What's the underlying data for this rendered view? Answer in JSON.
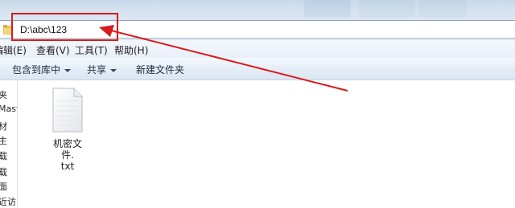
{
  "address": {
    "path": "D:\\abc\\123"
  },
  "menu": {
    "items": [
      {
        "label": "编辑(E)"
      },
      {
        "label": "查看(V)"
      },
      {
        "label": "工具(T)"
      },
      {
        "label": "帮助(H)"
      }
    ]
  },
  "commandbar": {
    "items": [
      {
        "label": "包含到库中"
      },
      {
        "label": "共享"
      },
      {
        "label": "新建文件夹"
      }
    ]
  },
  "navpane": {
    "items": [
      {
        "label": "夹"
      },
      {
        "label": "Mast"
      },
      {
        "label": "材"
      },
      {
        "label": "主"
      },
      {
        "label": "载"
      },
      {
        "label": "载"
      },
      {
        "label": "面"
      },
      {
        "label": "近访"
      }
    ]
  },
  "files": [
    {
      "name_line1": "机密文件.",
      "name_line2": "txt",
      "icon": "text-file-icon"
    }
  ],
  "annotation": {
    "color": "#d81b1b"
  }
}
